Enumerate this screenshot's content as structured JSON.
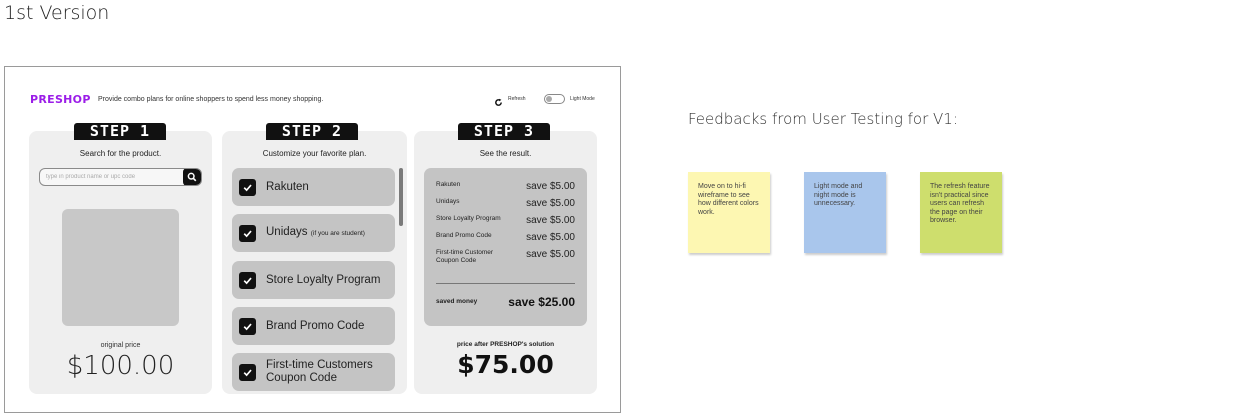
{
  "page_title": "1st Version",
  "header": {
    "brand": "PRESHOP",
    "tagline": "Provide combo plans for online shoppers to spend less money shopping.",
    "refresh_label": "Refresh",
    "mode_label": "Light Mode",
    "mode_on": false
  },
  "step1": {
    "tab": "STEP 1",
    "subtitle": "Search for the product.",
    "search_placeholder": "type in product name or upc code",
    "original_price_label": "original price",
    "original_price": "$100.00"
  },
  "step2": {
    "tab": "STEP 2",
    "subtitle": "Customize your favorite plan.",
    "plans": [
      {
        "label": "Rakuten",
        "note": "",
        "checked": true
      },
      {
        "label": "Unidays",
        "note": "(if you are student)",
        "checked": true
      },
      {
        "label": "Store Loyalty Program",
        "note": "",
        "checked": true
      },
      {
        "label": "Brand Promo Code",
        "note": "",
        "checked": true
      },
      {
        "label": "First-time Customers Coupon Code",
        "note": "",
        "checked": true
      }
    ]
  },
  "step3": {
    "tab": "STEP 3",
    "subtitle": "See the result.",
    "rows": [
      {
        "name": "Rakuten",
        "save": "save $5.00"
      },
      {
        "name": "Unidays",
        "save": "save $5.00"
      },
      {
        "name": "Store Loyalty Program",
        "save": "save $5.00"
      },
      {
        "name": "Brand Promo Code",
        "save": "save $5.00"
      },
      {
        "name": "First-time Customer Coupon Code",
        "save": "save $5.00"
      }
    ],
    "saved_label": "saved money",
    "saved_value": "save $25.00",
    "after_label": "price after PRESHOP's solution",
    "after_value": "$75.00"
  },
  "feedback": {
    "title": "Feedbacks from User Testing for V1:",
    "notes": [
      {
        "text": "Move on to hi-fi wireframe to see how different colors work.",
        "color": "#fdf7b2"
      },
      {
        "text": "Light mode and night mode is unnecessary.",
        "color": "#a9c6ec"
      },
      {
        "text": "The refresh feature isn't practical since users can refresh the page on their browser.",
        "color": "#cede6d"
      }
    ]
  },
  "colors": {
    "brand": "#9b1de8",
    "panel": "#efefef",
    "card": "#c4c4c4",
    "dark": "#111111"
  },
  "icons": {
    "refresh": "refresh-icon",
    "search": "search-icon",
    "checkbox": "checkmark-icon"
  }
}
